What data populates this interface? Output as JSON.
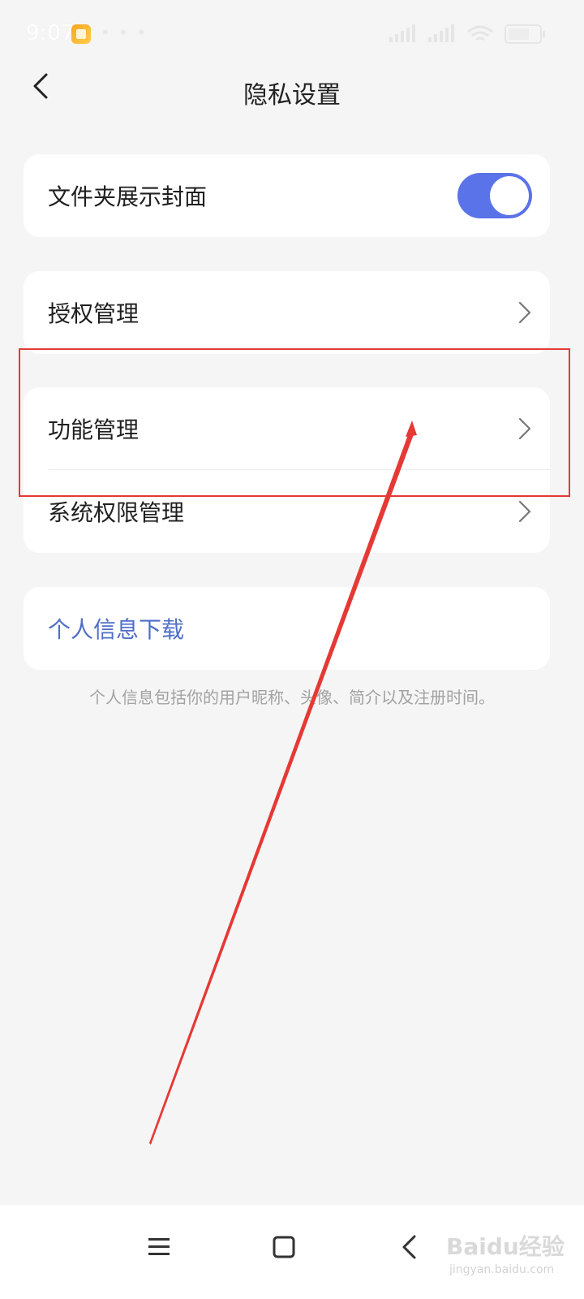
{
  "status_bar": {
    "time": "9:07",
    "dots": "• • •",
    "battery": "27"
  },
  "header": {
    "title": "隐私设置"
  },
  "settings": {
    "folder_cover": {
      "label": "文件夹展示封面",
      "enabled": true
    },
    "auth_manage": {
      "label": "授权管理"
    },
    "feature_manage": {
      "label": "功能管理"
    },
    "system_permission": {
      "label": "系统权限管理"
    },
    "personal_info_download": {
      "label": "个人信息下载"
    },
    "personal_info_note": "个人信息包括你的用户昵称、头像、简介以及注册时间。"
  },
  "watermark": {
    "brand": "Baidu经验",
    "site": "jingyan.baidu.com"
  },
  "colors": {
    "accent": "#5b73e8",
    "link": "#4f6ec7",
    "annotation": "#e53935",
    "background": "#f5f5f5"
  }
}
